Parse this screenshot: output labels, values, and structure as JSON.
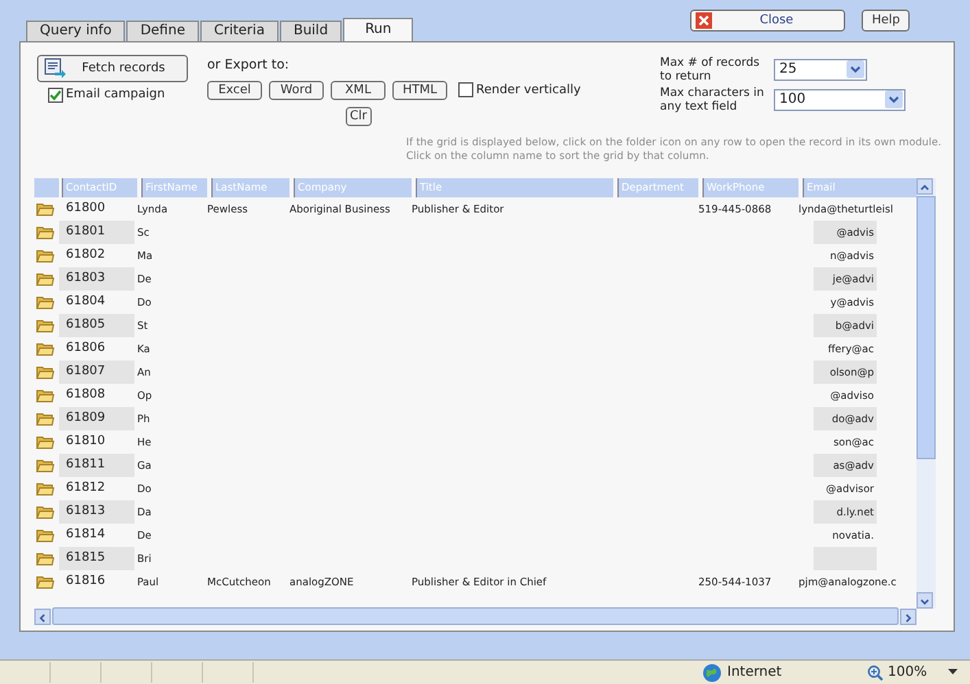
{
  "header": {
    "close_button": "Close",
    "help_button": "Help"
  },
  "tabs": [
    {
      "label": "Query info",
      "selected": false
    },
    {
      "label": "Define",
      "selected": false
    },
    {
      "label": "Criteria",
      "selected": false
    },
    {
      "label": "Build",
      "selected": false
    },
    {
      "label": "Run",
      "selected": true
    }
  ],
  "run": {
    "fetch_button": "Fetch records",
    "email_campaign": {
      "label": "Email campaign",
      "checked": true
    },
    "export_label": "or Export to:",
    "export_buttons": [
      "Excel",
      "Word",
      "XML",
      "HTML"
    ],
    "render_vertically": {
      "label": "Render vertically",
      "checked": false
    },
    "clear_button": "Clr",
    "max_records": {
      "label": "Max # of records to return",
      "value": "25"
    },
    "max_chars": {
      "label": "Max characters in any text field",
      "value": "100"
    },
    "hint": "If the grid is displayed below, click on the folder icon on any row to open the record in its own module. Click on the column name to sort the grid by that column."
  },
  "grid": {
    "columns": [
      "ContactID",
      "FirstName",
      "LastName",
      "Company",
      "Title",
      "Department",
      "WorkPhone",
      "Email"
    ],
    "rows": [
      {
        "kind": "full",
        "cells": [
          "61800",
          "Lynda",
          "Pewless",
          "Aboriginal Business",
          "Publisher & Editor",
          "",
          "519-445-0868",
          "lynda@theturtleisl"
        ]
      },
      {
        "kind": "partial",
        "id": "61801",
        "first": "Sc",
        "email": "@advis"
      },
      {
        "kind": "partial",
        "id": "61802",
        "first": "Ma",
        "email": "n@advis"
      },
      {
        "kind": "partial",
        "id": "61803",
        "first": "De",
        "email": "je@advi"
      },
      {
        "kind": "partial",
        "id": "61804",
        "first": "Do",
        "email": "y@advis"
      },
      {
        "kind": "partial",
        "id": "61805",
        "first": "St",
        "email": "b@advi"
      },
      {
        "kind": "partial",
        "id": "61806",
        "first": "Ka",
        "email": "ffery@ac"
      },
      {
        "kind": "partial",
        "id": "61807",
        "first": "An",
        "email": "olson@p"
      },
      {
        "kind": "partial",
        "id": "61808",
        "first": "Op",
        "email": "@adviso"
      },
      {
        "kind": "partial",
        "id": "61809",
        "first": "Ph",
        "email": "do@adv"
      },
      {
        "kind": "partial",
        "id": "61810",
        "first": "He",
        "email": "son@ac"
      },
      {
        "kind": "partial",
        "id": "61811",
        "first": "Ga",
        "email": "as@adv"
      },
      {
        "kind": "partial",
        "id": "61812",
        "first": "Do",
        "email": "@advisor"
      },
      {
        "kind": "partial",
        "id": "61813",
        "first": "Da",
        "email": "d.ly.net"
      },
      {
        "kind": "partial",
        "id": "61814",
        "first": "De",
        "email": "novatia."
      },
      {
        "kind": "partial",
        "id": "61815",
        "first": "Bri",
        "email": ""
      },
      {
        "kind": "full",
        "cells": [
          "61816",
          "Paul",
          "McCutcheon",
          "analogZONE",
          "Publisher & Editor in Chief",
          "",
          "250-544-1037",
          "pjm@analogzone.c"
        ]
      }
    ]
  },
  "status_bar": {
    "zone": "Internet",
    "zoom": "100%"
  }
}
